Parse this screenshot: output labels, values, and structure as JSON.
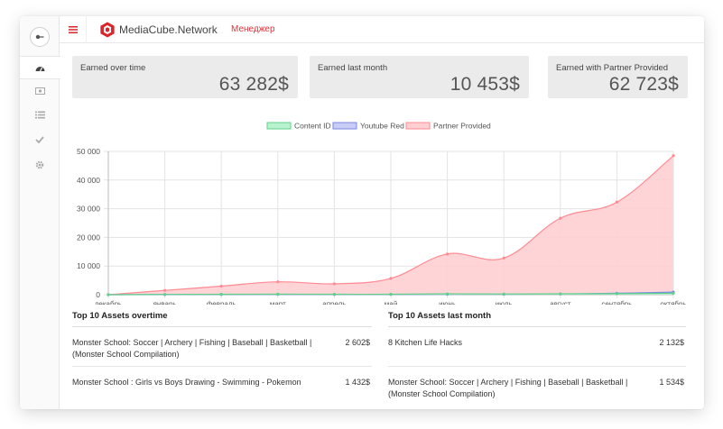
{
  "header": {
    "logo_text": "MediaCube.Network",
    "manager_label": "Менеджер"
  },
  "stats": [
    {
      "label": "Earned over time",
      "value": "63 282$"
    },
    {
      "label": "Earned last month",
      "value": "10 453$"
    },
    {
      "label": "Earned with Partner Provided",
      "value": "62 723$"
    }
  ],
  "colors": {
    "brand_red": "#e0323a",
    "content_id_fill": "#b9f2cf",
    "content_id_stroke": "#5fd18a",
    "youtube_red_fill": "#c7cdf5",
    "youtube_red_stroke": "#7c86e6",
    "partner_fill": "#ffcfd2",
    "partner_stroke": "#ff8a92"
  },
  "icons": {
    "back": "arrow-left-icon",
    "dashboard": "dashboard-icon",
    "money": "money-icon",
    "list": "list-icon",
    "check": "check-icon",
    "settings": "gear-icon",
    "menu": "hamburger-icon"
  },
  "chart_data": {
    "type": "area",
    "categories": [
      "декабрь",
      "январь",
      "февраль",
      "март",
      "апрель",
      "май",
      "июнь",
      "июль",
      "август",
      "сентябрь",
      "октябрь"
    ],
    "series": [
      {
        "name": "Content ID",
        "values": [
          0,
          100,
          150,
          200,
          150,
          150,
          300,
          250,
          300,
          350,
          500
        ]
      },
      {
        "name": "Youtube Red",
        "values": [
          0,
          50,
          80,
          100,
          80,
          100,
          150,
          150,
          250,
          500,
          900
        ]
      },
      {
        "name": "Partner Provided",
        "values": [
          0,
          1500,
          3000,
          4500,
          3800,
          5700,
          14200,
          12800,
          26700,
          32300,
          48500
        ]
      }
    ],
    "yticks": [
      "0",
      "10 000",
      "20 000",
      "30 000",
      "40 000",
      "50 000"
    ],
    "ylim": [
      0,
      50000
    ],
    "grid": true,
    "legend": "top-center"
  },
  "tables": {
    "overtime": {
      "title": "Top 10 Assets overtime",
      "rows": [
        {
          "name": "Monster School: Soccer | Archery | Fishing | Baseball | Basketball | (Monster School Compilation)",
          "value": "2 602$"
        },
        {
          "name": "Monster School : Girls vs Boys Drawing - Swimming - Pokemon",
          "value": "1 432$"
        }
      ]
    },
    "last_month": {
      "title": "Top 10 Assets last month",
      "rows": [
        {
          "name": "8 Kitchen Life Hacks",
          "value": "2 132$"
        },
        {
          "name": "Monster School: Soccer | Archery | Fishing | Baseball | Basketball | (Monster School Compilation)",
          "value": "1 534$"
        }
      ]
    }
  }
}
